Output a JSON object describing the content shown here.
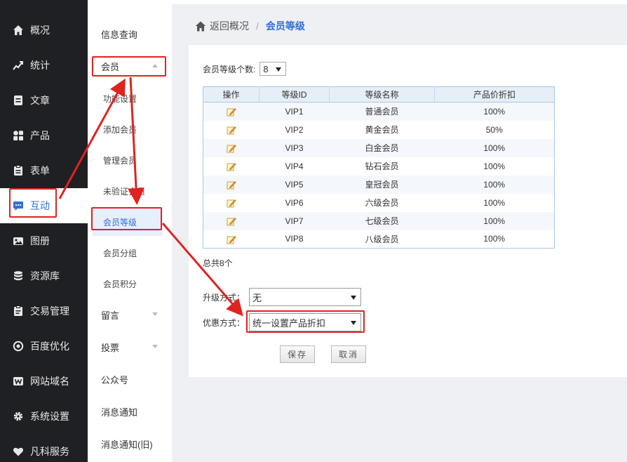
{
  "left_nav": {
    "items": [
      {
        "label": "概况",
        "icon": "home-icon"
      },
      {
        "label": "统计",
        "icon": "chart-icon"
      },
      {
        "label": "文章",
        "icon": "document-icon"
      },
      {
        "label": "产品",
        "icon": "grid-icon"
      },
      {
        "label": "表单",
        "icon": "clipboard-icon"
      },
      {
        "label": "互动",
        "icon": "chat-icon"
      },
      {
        "label": "图册",
        "icon": "image-icon"
      },
      {
        "label": "资源库",
        "icon": "database-icon"
      },
      {
        "label": "交易管理",
        "icon": "order-icon"
      },
      {
        "label": "百度优化",
        "icon": "target-icon"
      },
      {
        "label": "网站域名",
        "icon": "w-badge-icon"
      },
      {
        "label": "系统设置",
        "icon": "gear-icon"
      },
      {
        "label": "凡科服务",
        "icon": "heart-icon"
      }
    ],
    "active": "互动"
  },
  "sub_menu": {
    "items": [
      {
        "label": "信息查询"
      },
      {
        "label": "会员"
      },
      {
        "label": "功能设置"
      },
      {
        "label": "添加会员"
      },
      {
        "label": "管理会员"
      },
      {
        "label": "未验证会员"
      },
      {
        "label": "会员等级"
      },
      {
        "label": "会员分组"
      },
      {
        "label": "会员积分"
      },
      {
        "label": "留言"
      },
      {
        "label": "投票"
      },
      {
        "label": "公众号"
      },
      {
        "label": "消息通知"
      },
      {
        "label": "消息通知(旧)"
      }
    ],
    "selected": "会员等级"
  },
  "breadcrumb": {
    "back_label": "返回概况",
    "separator": "/",
    "current": "会员等级"
  },
  "level_count": {
    "label": "会员等级个数:",
    "value": "8"
  },
  "table": {
    "headers": [
      "操作",
      "等级ID",
      "等级名称",
      "产品价折扣"
    ],
    "rows": [
      {
        "id": "VIP1",
        "name": "普通会员",
        "discount": "100%"
      },
      {
        "id": "VIP2",
        "name": "黄金会员",
        "discount": "50%"
      },
      {
        "id": "VIP3",
        "name": "白金会员",
        "discount": "100%"
      },
      {
        "id": "VIP4",
        "name": "钻石会员",
        "discount": "100%"
      },
      {
        "id": "VIP5",
        "name": "皇冠会员",
        "discount": "100%"
      },
      {
        "id": "VIP6",
        "name": "六级会员",
        "discount": "100%"
      },
      {
        "id": "VIP7",
        "name": "七级会员",
        "discount": "100%"
      },
      {
        "id": "VIP8",
        "name": "八级会员",
        "discount": "100%"
      }
    ]
  },
  "total_text": "总共8个",
  "upgrade": {
    "label": "升级方式：",
    "value": "无"
  },
  "discount_mode": {
    "label": "优惠方式：",
    "value": "统一设置产品折扣"
  },
  "buttons": {
    "save": "保存",
    "cancel": "取消"
  },
  "colors": {
    "sidebar_bg": "#1f2023",
    "accent": "#2f6fd6",
    "annotation": "#e0231f",
    "table_border": "#a9c7e3"
  }
}
